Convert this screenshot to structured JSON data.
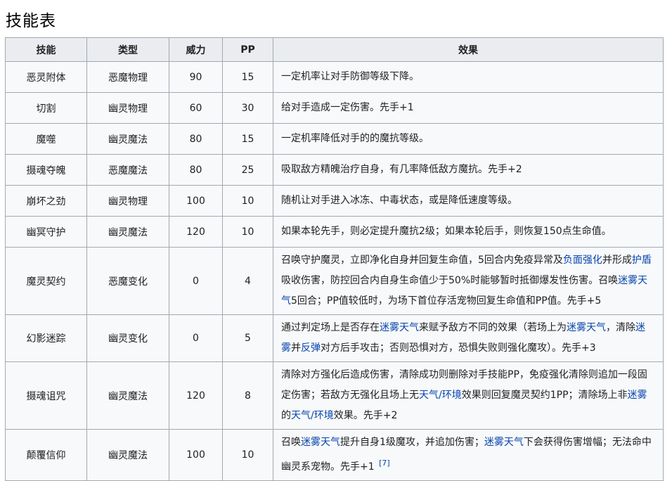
{
  "page_title": "技能表",
  "table": {
    "headers": [
      "技能",
      "类型",
      "威力",
      "PP",
      "效果"
    ],
    "rows": [
      {
        "name": "恶灵附体",
        "type": "恶魔物理",
        "power": "90",
        "pp": "15",
        "effect": [
          {
            "t": "一定机率让对手防御等级下降。"
          }
        ]
      },
      {
        "name": "切割",
        "type": "幽灵物理",
        "power": "60",
        "pp": "30",
        "effect": [
          {
            "t": "给对手造成一定伤害。先手+1"
          }
        ]
      },
      {
        "name": "魔噬",
        "type": "幽灵魔法",
        "power": "80",
        "pp": "15",
        "effect": [
          {
            "t": "一定机率降低对手的的魔抗等级。"
          }
        ]
      },
      {
        "name": "摄魂夺魄",
        "type": "恶魔魔法",
        "power": "80",
        "pp": "25",
        "effect": [
          {
            "t": "吸取敌方精魄治疗自身，有几率降低敌方魔抗。先手+2"
          }
        ]
      },
      {
        "name": "崩坏之劲",
        "type": "幽灵物理",
        "power": "100",
        "pp": "10",
        "effect": [
          {
            "t": "随机让对手进入冰冻、中毒状态，或是降低速度等级。"
          }
        ]
      },
      {
        "name": "幽冥守护",
        "type": "幽灵魔法",
        "power": "120",
        "pp": "10",
        "effect": [
          {
            "t": "如果本轮先手，则必定提升魔抗2级；如果本轮后手，则恢复150点生命值。"
          }
        ]
      },
      {
        "name": "魔灵契约",
        "type": "恶魔变化",
        "power": "0",
        "pp": "4",
        "effect": [
          {
            "t": "召唤守护魔灵，立即净化自身并回复生命值，5回合内免疫异常及"
          },
          {
            "t": "负面强化",
            "link": true
          },
          {
            "t": "并形成"
          },
          {
            "t": "护盾",
            "link": true
          },
          {
            "t": "吸收伤害，防控回合内自身生命值少于50%时能够暂时抵御爆发性伤害。召唤"
          },
          {
            "t": "迷雾天气",
            "link": true
          },
          {
            "t": "5回合；PP值较低时，为场下首位存活宠物回复生命值和PP值。先手+5"
          }
        ]
      },
      {
        "name": "幻影迷踪",
        "type": "幽灵变化",
        "power": "0",
        "pp": "5",
        "effect": [
          {
            "t": "通过判定场上是否存在"
          },
          {
            "t": "迷雾天气",
            "link": true
          },
          {
            "t": "来赋予敌方不同的效果（若场上为"
          },
          {
            "t": "迷雾天气",
            "link": true
          },
          {
            "t": "，清除"
          },
          {
            "t": "迷雾",
            "link": true
          },
          {
            "t": "并"
          },
          {
            "t": "反弹",
            "link": true
          },
          {
            "t": "对方后手攻击；否则恐惧对方，恐惧失败则强化魔攻）。先手+3"
          }
        ]
      },
      {
        "name": "摄魂诅咒",
        "type": "幽灵魔法",
        "power": "120",
        "pp": "8",
        "effect": [
          {
            "t": "清除对方强化后造成伤害，清除成功则删除对手技能PP，免疫强化清除则追加一段固定伤害；若敌方无强化且场上无"
          },
          {
            "t": "天气/环境",
            "link": true
          },
          {
            "t": "效果则回复魔灵契约1PP；清除场上非"
          },
          {
            "t": "迷雾",
            "link": true
          },
          {
            "t": "的"
          },
          {
            "t": "天气/环境",
            "link": true
          },
          {
            "t": "效果。先手+2"
          }
        ]
      },
      {
        "name": "颠覆信仰",
        "type": "幽灵魔法",
        "power": "100",
        "pp": "10",
        "effect": [
          {
            "t": "召唤"
          },
          {
            "t": "迷雾天气",
            "link": true
          },
          {
            "t": "提升自身1级魔攻，并追加伤害；"
          },
          {
            "t": "迷雾天气",
            "link": true
          },
          {
            "t": "下会获得伤害增幅；无法命中幽灵系宠物。先手+1 "
          },
          {
            "t": "[7]",
            "ref": true
          }
        ]
      }
    ]
  }
}
